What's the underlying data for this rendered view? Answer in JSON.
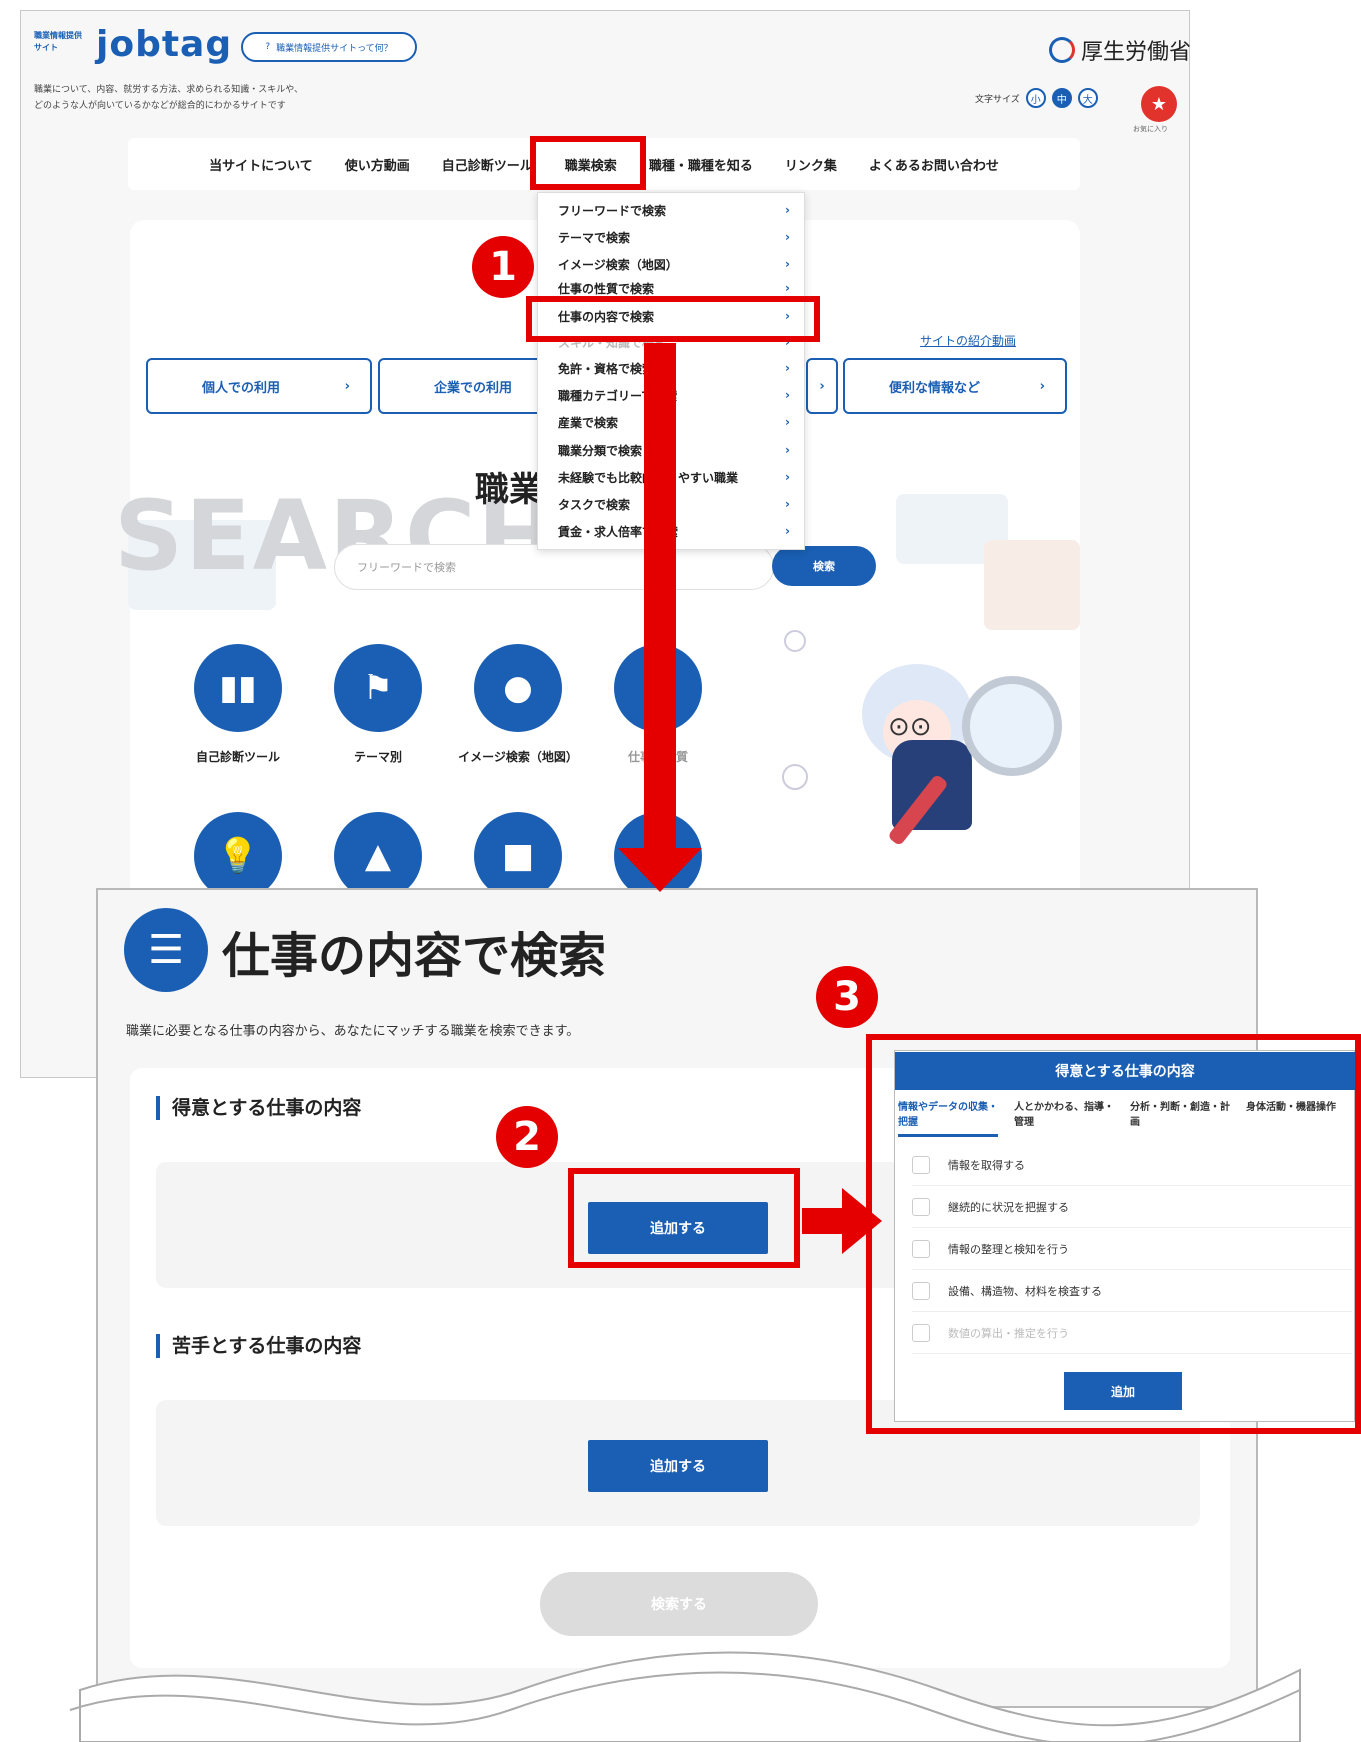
{
  "header": {
    "logo_blocks": "職業情報提供サイト",
    "logo_text": "jobtag",
    "pill_label": "職業情報提供サイトって何？",
    "tagline_1": "職業について、内容、就労する方法、求められる知識・スキルや、",
    "tagline_2": "どのような人が向いているかなどが総合的にわかるサイトです",
    "ministry": "厚生労働省",
    "fontsize_label": "文字サイズ",
    "fs_small": "小",
    "fs_mid": "中",
    "fs_large": "大",
    "favorite_label": "お気に入り"
  },
  "nav": {
    "items": [
      "当サイトについて",
      "使い方動画",
      "自己診断ツール",
      "職業検索",
      "職種・職種を知る",
      "リンク集",
      "よくあるお問い合わせ"
    ]
  },
  "dropdown": {
    "items": [
      "フリーワードで検索",
      "テーマで検索",
      "イメージ検索（地図）",
      "仕事の性質で検索",
      "仕事の内容で検索",
      "スキル・知識で検索",
      "免許・資格で検索",
      "職種カテゴリーで検索",
      "産業で検索",
      "職業分類で検索",
      "未経験でも比較的入りやすい職業",
      "タスクで検索",
      "賃金・求人倍率で検索"
    ],
    "chevron": "›"
  },
  "badges": {
    "one": "1",
    "two": "2",
    "three": "3"
  },
  "home": {
    "site_video": "サイトの紹介動画",
    "usage_buttons": [
      "個人での利用",
      "企業での利用",
      "便利な情報など"
    ],
    "search_word": "SEARCH",
    "shokugyo": "職業",
    "search_placeholder": "フリーワードで検索",
    "search_button": "検索",
    "circles": [
      "自己診断ツール",
      "テーマ別",
      "イメージ検索（地図）",
      "仕事の性質"
    ]
  },
  "detail": {
    "title": "仕事の内容で検索",
    "description": "職業に必要となる仕事の内容から、あなたにマッチする職業を検索できます。",
    "section_good": "得意とする仕事の内容",
    "section_bad": "苦手とする仕事の内容",
    "add_button": "追加する",
    "search_button": "検索する"
  },
  "modal": {
    "title": "得意とする仕事の内容",
    "tabs": [
      "情報やデータの収集・把握",
      "人とかかわる、指導・管理",
      "分析・判断・創造・計画",
      "身体活動・機器操作"
    ],
    "rows": [
      "情報を取得する",
      "継続的に状況を把握する",
      "情報の整理と検知を行う",
      "設備、構造物、材料を検査する",
      "数値の算出・推定を行う"
    ],
    "add": "追加"
  },
  "colors": {
    "brand": "#1a5fb4",
    "highlight": "#e40000"
  }
}
